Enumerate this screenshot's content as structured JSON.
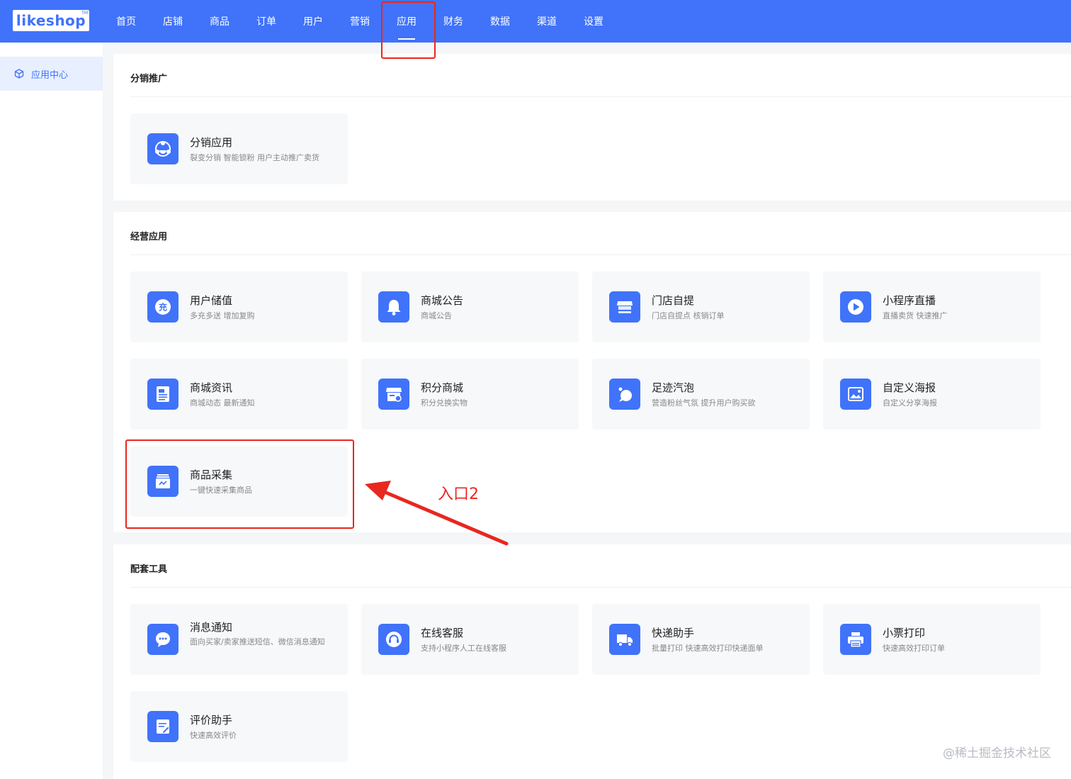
{
  "header": {
    "logo_text": "likeshop",
    "logo_tm": "TM",
    "nav": [
      {
        "label": "首页"
      },
      {
        "label": "店铺"
      },
      {
        "label": "商品"
      },
      {
        "label": "订单"
      },
      {
        "label": "用户"
      },
      {
        "label": "营销"
      },
      {
        "label": "应用",
        "active": true
      },
      {
        "label": "财务"
      },
      {
        "label": "数据"
      },
      {
        "label": "渠道"
      },
      {
        "label": "设置"
      }
    ],
    "brand_color": "#4073fa"
  },
  "sidebar": {
    "items": [
      {
        "label": "应用中心",
        "icon": "cube-icon",
        "active": true
      }
    ]
  },
  "sections": [
    {
      "title": "分销推广",
      "cards": [
        {
          "title": "分销应用",
          "desc": "裂变分销 智能锁粉 用户主动推广卖货",
          "icon": "share-people-icon"
        }
      ]
    },
    {
      "title": "经营应用",
      "cards": [
        {
          "title": "用户储值",
          "desc": "多充多送 增加复购",
          "icon": "recharge-icon"
        },
        {
          "title": "商城公告",
          "desc": "商城公告",
          "icon": "bell-icon"
        },
        {
          "title": "门店自提",
          "desc": "门店自提点 核销订单",
          "icon": "store-icon"
        },
        {
          "title": "小程序直播",
          "desc": "直播卖货 快速推广",
          "icon": "play-icon"
        },
        {
          "title": "商城资讯",
          "desc": "商城动态 最新通知",
          "icon": "news-icon"
        },
        {
          "title": "积分商城",
          "desc": "积分兑换实物",
          "icon": "points-shop-icon"
        },
        {
          "title": "足迹汽泡",
          "desc": "营造粉丝气氛 提升用户购买欲",
          "icon": "bubble-icon"
        },
        {
          "title": "自定义海报",
          "desc": "自定义分享海报",
          "icon": "poster-icon"
        },
        {
          "title": "商品采集",
          "desc": "一键快速采集商品",
          "icon": "collect-icon"
        }
      ]
    },
    {
      "title": "配套工具",
      "cards": [
        {
          "title": "消息通知",
          "desc": "面向买家/卖家推送短信、微信消息通知",
          "icon": "message-icon"
        },
        {
          "title": "在线客服",
          "desc": "支持小程序人工在线客服",
          "icon": "headset-icon"
        },
        {
          "title": "快递助手",
          "desc": "批量打印 快速高效打印快递面单",
          "icon": "truck-icon"
        },
        {
          "title": "小票打印",
          "desc": "快速高效打印订单",
          "icon": "printer-icon"
        },
        {
          "title": "评价助手",
          "desc": "快速高效评价",
          "icon": "review-icon"
        }
      ]
    }
  ],
  "annotation": {
    "label": "入口2",
    "color": "#e8271f"
  },
  "watermark": "@稀土掘金技术社区"
}
